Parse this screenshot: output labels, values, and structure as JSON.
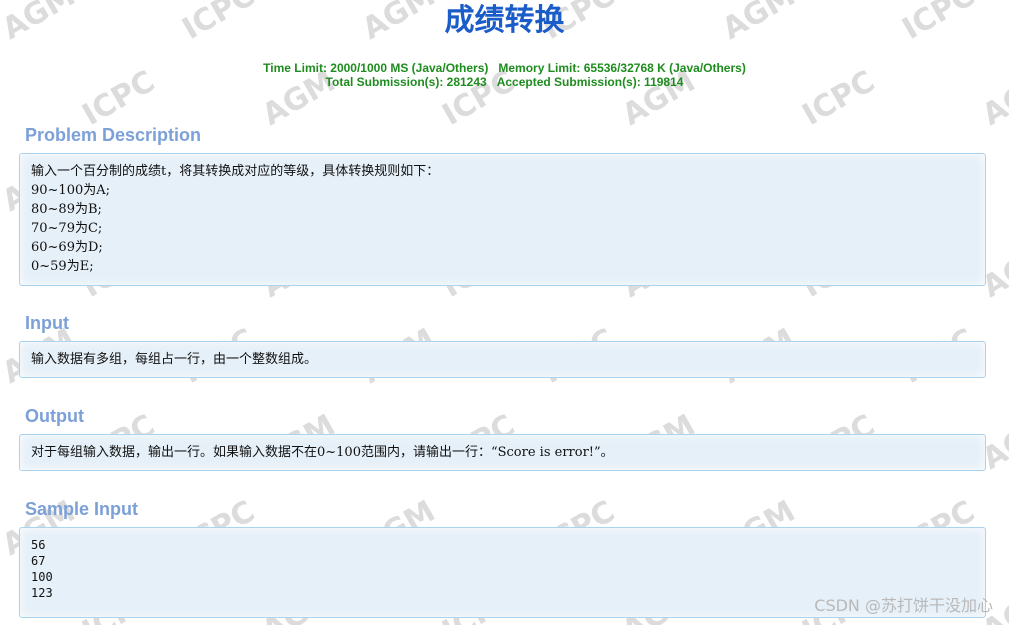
{
  "title": "成绩转换",
  "limits": {
    "time_limit": "Time Limit: 2000/1000 MS (Java/Others)",
    "memory_limit": "Memory Limit: 65536/32768 K (Java/Others)",
    "total_submissions": "Total Submission(s): 281243",
    "accepted_submissions": "Accepted Submission(s): 119814"
  },
  "sections": {
    "description": {
      "heading": "Problem Description",
      "lines": [
        "输入一个百分制的成绩t，将其转换成对应的等级，具体转换规则如下：",
        "90~100为A;",
        "80~89为B;",
        "70~79为C;",
        "60~69为D;",
        "0~59为E;"
      ]
    },
    "input": {
      "heading": "Input",
      "text": "输入数据有多组，每组占一行，由一个整数组成。"
    },
    "output": {
      "heading": "Output",
      "text": "对于每组输入数据，输出一行。如果输入数据不在0~100范围内，请输出一行：“Score is error!”。"
    },
    "sample_input": {
      "heading": "Sample Input",
      "lines": [
        "56",
        "67",
        "100",
        "123"
      ]
    }
  },
  "watermark": {
    "words": [
      "AGM",
      "ICPC"
    ],
    "color": "#dcdcdc"
  },
  "footer": {
    "credit": "CSDN @苏打饼干没加心"
  },
  "colors": {
    "title": "#1a5cc8",
    "limits": "#1f8c1f",
    "section_heading": "#7ca0d8",
    "box_background": "#e6f0f8",
    "box_border": "#a9d4ef"
  }
}
